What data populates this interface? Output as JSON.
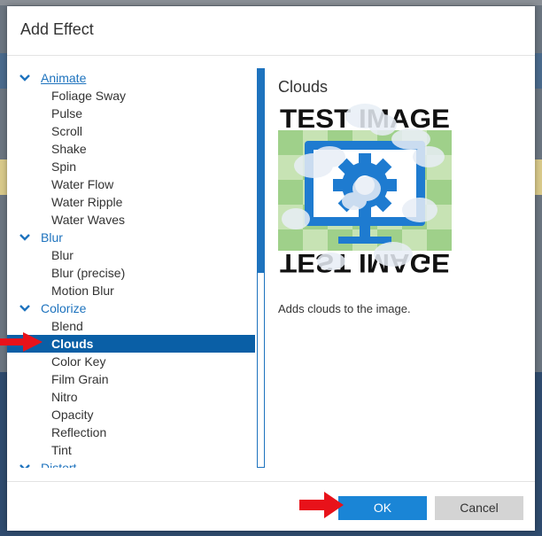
{
  "dialog": {
    "title": "Add Effect"
  },
  "tree": {
    "groups": [
      {
        "label": "Animate",
        "items": [
          "Foliage Sway",
          "Pulse",
          "Scroll",
          "Shake",
          "Spin",
          "Water Flow",
          "Water Ripple",
          "Water Waves"
        ]
      },
      {
        "label": "Blur",
        "items": [
          "Blur",
          "Blur (precise)",
          "Motion Blur"
        ]
      },
      {
        "label": "Colorize",
        "items": [
          "Blend",
          "Clouds",
          "Color Key",
          "Film Grain",
          "Nitro",
          "Opacity",
          "Reflection",
          "Tint"
        ]
      },
      {
        "label": "Distort",
        "items": []
      }
    ],
    "selected": "Clouds"
  },
  "detail": {
    "title": "Clouds",
    "preview_text_top": "TEST IMAGE",
    "preview_text_bottom": "TEST IMAGE",
    "description": "Adds clouds to the image."
  },
  "footer": {
    "ok_label": "OK",
    "cancel_label": "Cancel"
  },
  "colors": {
    "accent": "#1e73be",
    "selected_bg": "#0a5fa6",
    "ok_bg": "#1a85d6",
    "arrow": "#e8121a"
  }
}
